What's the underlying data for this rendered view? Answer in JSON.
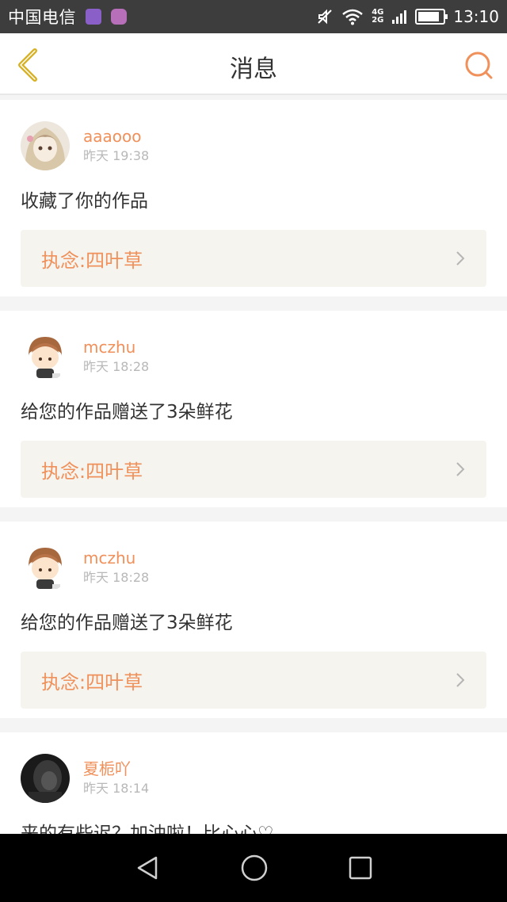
{
  "status_bar": {
    "carrier": "中国电信",
    "network": "4G 2G",
    "time": "13:10"
  },
  "header": {
    "title": "消息",
    "back_icon": "chevron-left-icon",
    "search_icon": "search-icon"
  },
  "messages": [
    {
      "user": "aaaooo",
      "time": "昨天 19:38",
      "text": "收藏了你的作品",
      "work": "执念:四叶草",
      "avatar": "girl-avatar"
    },
    {
      "user": "mczhu",
      "time": "昨天 18:28",
      "text": "给您的作品赠送了3朵鲜花",
      "work": "执念:四叶草",
      "avatar": "boy-avatar"
    },
    {
      "user": "mczhu",
      "time": "昨天 18:28",
      "text": "给您的作品赠送了3朵鲜花",
      "work": "执念:四叶草",
      "avatar": "boy-avatar"
    },
    {
      "user": "夏栀吖",
      "time": "昨天 18:14",
      "text": "来的有些迟？加油啦！比心心♡",
      "work": "",
      "avatar": "dark-avatar"
    }
  ],
  "nav_bar": {
    "back": "back-triangle-icon",
    "home": "home-circle-icon",
    "recent": "recents-square-icon"
  },
  "colors": {
    "accent": "#f0905a",
    "back_icon": "#c8a000",
    "status_bar": "#3d3d3d",
    "nav_bar": "#000000"
  }
}
